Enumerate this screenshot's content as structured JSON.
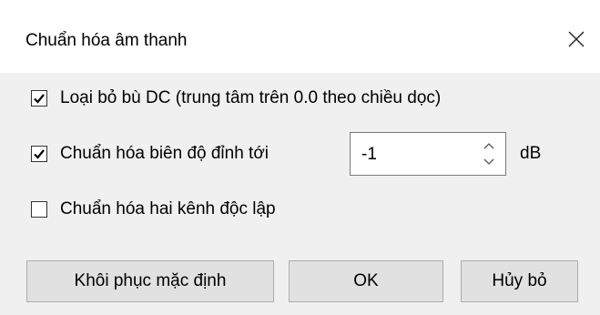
{
  "dialog": {
    "title": "Chuẩn hóa âm thanh",
    "close_icon": "close-icon"
  },
  "options": {
    "remove_dc": {
      "label": "Loại bỏ bù DC (trung tâm trên 0.0 theo chiều dọc)",
      "checked": true
    },
    "normalize_peak": {
      "label": "Chuẩn hóa biên độ đỉnh tới",
      "checked": true,
      "value": "-1",
      "unit": "dB"
    },
    "independent_channels": {
      "label": "Chuẩn hóa hai kênh độc lập",
      "checked": false
    }
  },
  "buttons": {
    "restore_defaults": "Khôi phục mặc định",
    "ok": "OK",
    "cancel": "Hủy bỏ"
  }
}
